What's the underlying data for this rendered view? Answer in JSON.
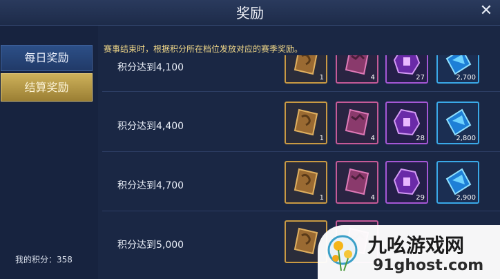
{
  "window": {
    "title": "奖励",
    "close_icon": "close-icon"
  },
  "sidebar": {
    "tabs": [
      {
        "label": "每日奖励",
        "state": "normal"
      },
      {
        "label": "结算奖励",
        "state": "selected"
      }
    ],
    "score_label": "我的积分：358"
  },
  "notice": "赛事结束时，根据积分所在档位发放对应的赛季奖励。",
  "reward_tiers": [
    {
      "label": "积分达到4,100",
      "rewards": [
        {
          "icon": "gold-card-icon",
          "qty": "1"
        },
        {
          "icon": "pink-card-icon",
          "qty": "4"
        },
        {
          "icon": "purple-gem-icon",
          "qty": "27"
        },
        {
          "icon": "blue-diamond-icon",
          "qty": "2,700"
        }
      ]
    },
    {
      "label": "积分达到4,400",
      "rewards": [
        {
          "icon": "gold-card-icon",
          "qty": "1"
        },
        {
          "icon": "pink-card-icon",
          "qty": "4"
        },
        {
          "icon": "purple-gem-icon",
          "qty": "28"
        },
        {
          "icon": "blue-diamond-icon",
          "qty": "2,800"
        }
      ]
    },
    {
      "label": "积分达到4,700",
      "rewards": [
        {
          "icon": "gold-card-icon",
          "qty": "1"
        },
        {
          "icon": "pink-card-icon",
          "qty": "4"
        },
        {
          "icon": "purple-gem-icon",
          "qty": "29"
        },
        {
          "icon": "blue-diamond-icon",
          "qty": "2,900"
        }
      ]
    },
    {
      "label": "积分达到5,000",
      "rewards": [
        {
          "icon": "gold-card-icon",
          "qty": ""
        },
        {
          "icon": "pink-card-icon",
          "qty": ""
        }
      ]
    }
  ],
  "watermark": {
    "name": "九吆游戏网",
    "url": "91ghost.com"
  },
  "colors": {
    "background": "#1a2744",
    "gold_accent": "#c99a43",
    "pink_accent": "#c65a98",
    "purple_accent": "#a557d6",
    "blue_accent": "#3aa9e8"
  }
}
